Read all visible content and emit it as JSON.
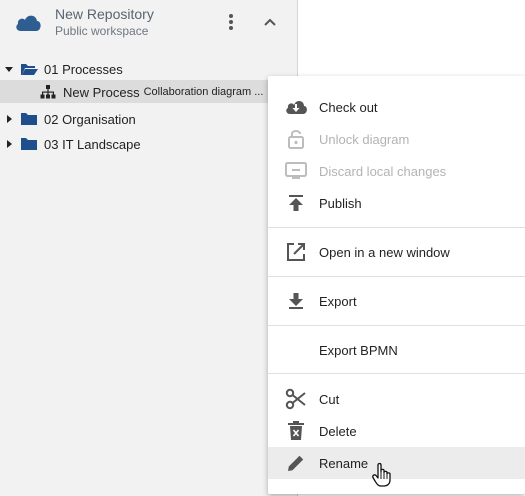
{
  "repository": {
    "title": "New Repository",
    "subtitle": "Public workspace"
  },
  "tree": {
    "folders": [
      {
        "label": "01 Processes",
        "expanded": true
      },
      {
        "label": "02 Organisation",
        "expanded": false
      },
      {
        "label": "03 IT Landscape",
        "expanded": false
      }
    ],
    "selected_item": {
      "name": "New Process",
      "type": "Collaboration diagram ..."
    }
  },
  "context_menu": {
    "groups": [
      [
        {
          "label": "Check out",
          "icon": "cloud-download-icon",
          "enabled": true
        },
        {
          "label": "Unlock diagram",
          "icon": "unlock-icon",
          "enabled": false
        },
        {
          "label": "Discard local changes",
          "icon": "discard-icon",
          "enabled": false
        },
        {
          "label": "Publish",
          "icon": "publish-icon",
          "enabled": true
        }
      ],
      [
        {
          "label": "Open in a new window",
          "icon": "open-external-icon",
          "enabled": true
        }
      ],
      [
        {
          "label": "Export",
          "icon": "export-icon",
          "enabled": true
        }
      ],
      [
        {
          "label": "Export BPMN",
          "icon": "",
          "enabled": true
        }
      ],
      [
        {
          "label": "Cut",
          "icon": "scissors-icon",
          "enabled": true
        },
        {
          "label": "Delete",
          "icon": "trash-icon",
          "enabled": true
        },
        {
          "label": "Rename",
          "icon": "pencil-icon",
          "enabled": true,
          "hovered": true
        }
      ]
    ]
  },
  "colors": {
    "folder": "#1f4e8c",
    "cloud": "#2d5d91",
    "icon": "#555555",
    "disabled": "#bdbdbd",
    "selection": "#dcdcdc",
    "hover": "#ececec"
  }
}
